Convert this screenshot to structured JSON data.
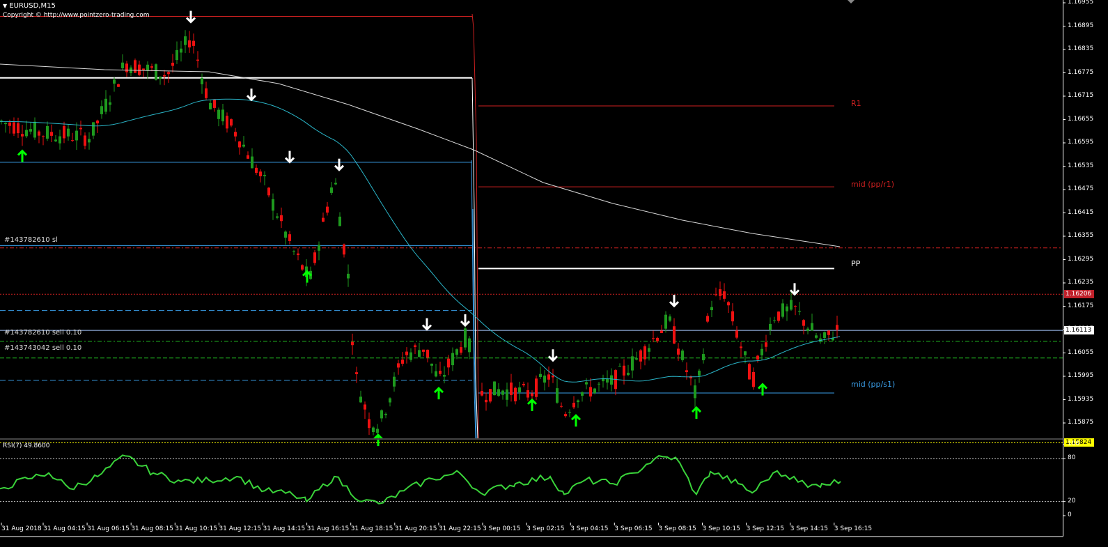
{
  "window": {
    "title": "EURUSD,M15",
    "copyright": "Copyright © http://www.pointzero-trading.com"
  },
  "indicator": {
    "label": "RSI(7) 49.8600",
    "scale": [
      "100",
      "80",
      "20",
      "0"
    ],
    "levels": [
      80,
      20
    ]
  },
  "price_axis": {
    "ticks": [
      "1.16955",
      "1.16895",
      "1.16835",
      "1.16775",
      "1.16715",
      "1.16655",
      "1.16595",
      "1.16535",
      "1.16475",
      "1.16415",
      "1.16355",
      "1.16295",
      "1.16235",
      "1.16175",
      "1.16115",
      "1.16055",
      "1.15995",
      "1.15935",
      "1.15875"
    ],
    "badges": [
      {
        "text": "1.16206",
        "bg": "#c0202a",
        "fg": "#ffffff",
        "price": 1.16206
      },
      {
        "text": "1.16113",
        "bg": "#ffffff",
        "fg": "#000000",
        "price": 1.16113
      },
      {
        "text": "1.15824",
        "bg": "#ffff00",
        "fg": "#000000",
        "price": 1.15824
      }
    ]
  },
  "time_axis": {
    "labels": [
      "31 Aug 2018",
      "31 Aug 04:15",
      "31 Aug 06:15",
      "31 Aug 08:15",
      "31 Aug 10:15",
      "31 Aug 12:15",
      "31 Aug 14:15",
      "31 Aug 16:15",
      "31 Aug 18:15",
      "31 Aug 20:15",
      "31 Aug 22:15",
      "3 Sep 00:15",
      "3 Sep 02:15",
      "3 Sep 04:15",
      "3 Sep 06:15",
      "3 Sep 08:15",
      "3 Sep 10:15",
      "3 Sep 12:15",
      "3 Sep 14:15",
      "3 Sep 16:15"
    ]
  },
  "pivots": {
    "r1": "R1",
    "mid_pp_r1": "mid (pp/r1)",
    "pp": "PP",
    "mid_pp_s1": "mid (pp/s1)"
  },
  "orders": {
    "sl": "#143782610 sl",
    "sell1": "#143782610 sell 0.10",
    "sell2": "#143743042 sell 0.10"
  },
  "colors": {
    "bull": "#1e9a1e",
    "bear": "#ee1111",
    "rsi": "#3ad33a",
    "ma_fast": "#2ab5c8",
    "ma_slow": "#d8d8d8",
    "r1": "#d02020",
    "pp": "#ffffff",
    "s_line": "#3a9ee8",
    "arrow_up": "#00ff00",
    "arrow_down": "#ffffff"
  },
  "icons": [
    "dropdown-triangle-icon",
    "arrow-up-icon",
    "arrow-down-icon"
  ]
}
